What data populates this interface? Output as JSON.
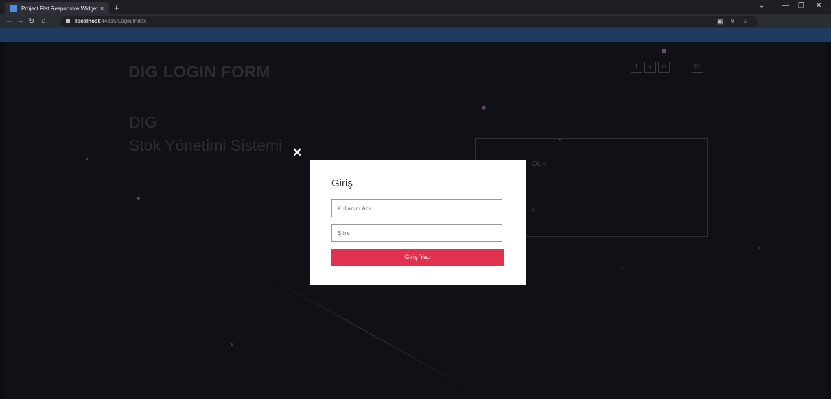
{
  "browser": {
    "tab_title": "Project Flat Responsive Widget | ",
    "tab_close": "×",
    "new_tab": "+",
    "url_host": "localhost",
    "url_path": ":44315/Login/Index",
    "window_controls": [
      "⌄",
      "—",
      "❐",
      "✕"
    ]
  },
  "page": {
    "brand": "DIG LOGIN FORM",
    "hero_line1": "DIG",
    "hero_line2": "Stok Yönetimi Sistemi",
    "social": [
      "f",
      "y",
      "in",
      "G+"
    ],
    "box_text_1": "OL »",
    "box_text_2": "»"
  },
  "modal": {
    "close": "✕",
    "title": "Giriş",
    "username_placeholder": "Kullanıcı Adı",
    "password_placeholder": "Şifre",
    "submit_label": "Giriş Yap"
  },
  "colors": {
    "accent": "#e0314f",
    "browser_bar": "#1f3b5d",
    "page_bg": "#101116"
  }
}
